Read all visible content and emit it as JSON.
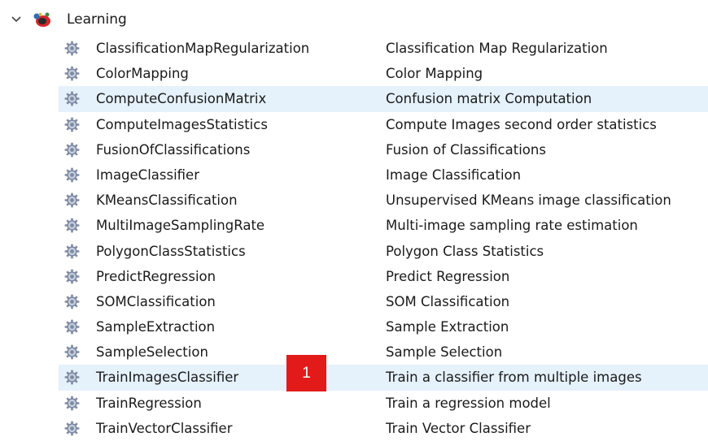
{
  "group": {
    "label": "Learning",
    "expanded": true,
    "expand_icon": "chevron-down-icon",
    "icon": "app-group-icon"
  },
  "rows": [
    {
      "name": "ClassificationMapRegularization",
      "description": "Classification Map Regularization",
      "selected": false
    },
    {
      "name": "ColorMapping",
      "description": "Color Mapping",
      "selected": false
    },
    {
      "name": "ComputeConfusionMatrix",
      "description": "Confusion matrix Computation",
      "selected": true
    },
    {
      "name": "ComputeImagesStatistics",
      "description": "Compute Images second order statistics",
      "selected": false
    },
    {
      "name": "FusionOfClassifications",
      "description": "Fusion of Classifications",
      "selected": false
    },
    {
      "name": "ImageClassifier",
      "description": "Image Classification",
      "selected": false
    },
    {
      "name": "KMeansClassification",
      "description": "Unsupervised KMeans image classification",
      "selected": false
    },
    {
      "name": "MultiImageSamplingRate",
      "description": "Multi-image sampling rate estimation",
      "selected": false
    },
    {
      "name": "PolygonClassStatistics",
      "description": "Polygon Class Statistics",
      "selected": false
    },
    {
      "name": "PredictRegression",
      "description": "Predict Regression",
      "selected": false
    },
    {
      "name": "SOMClassification",
      "description": "SOM Classification",
      "selected": false
    },
    {
      "name": "SampleExtraction",
      "description": "Sample Extraction",
      "selected": false
    },
    {
      "name": "SampleSelection",
      "description": "Sample Selection",
      "selected": false
    },
    {
      "name": "TrainImagesClassifier",
      "description": "Train a classifier from multiple images",
      "selected": true
    },
    {
      "name": "TrainRegression",
      "description": "Train a regression model",
      "selected": false
    },
    {
      "name": "TrainVectorClassifier",
      "description": "Train Vector Classifier",
      "selected": false
    }
  ],
  "annotation": {
    "label": "1",
    "color": "#e31a1a"
  },
  "colors": {
    "selected_row": "#e5f1fb",
    "gear": "#7d8aa3",
    "text": "#1a1a1a"
  }
}
